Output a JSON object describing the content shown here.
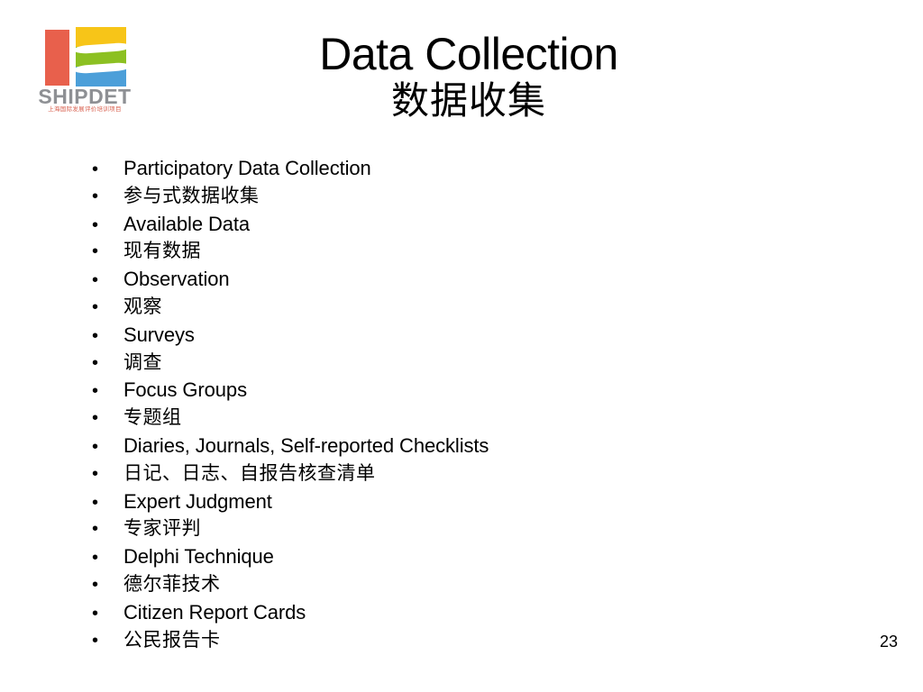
{
  "slide": {
    "title_en": "Data Collection",
    "title_zh": "数据收集",
    "page_number": "23",
    "background_color": "#FFFFFF",
    "text_color": "#000000"
  },
  "logo": {
    "wordmark": "SHIPDET",
    "subtext_zh": "上海国际发展评价培训项目",
    "wordmark_color": "#8E9094",
    "subtext_color": "#D8604F",
    "colors": {
      "bar_red": "#E8604C",
      "band_yellow": "#F7C518",
      "band_green": "#8CC022",
      "band_blue": "#4C9FD9"
    }
  },
  "bullets": [
    {
      "text": "Participatory Data Collection",
      "lang": "en"
    },
    {
      "text": "参与式数据收集",
      "lang": "zh"
    },
    {
      "text": "Available Data",
      "lang": "en"
    },
    {
      "text": "现有数据",
      "lang": "zh"
    },
    {
      "text": "Observation",
      "lang": "en"
    },
    {
      "text": "观察",
      "lang": "zh"
    },
    {
      "text": "Surveys",
      "lang": "en"
    },
    {
      "text": "调查",
      "lang": "zh"
    },
    {
      "text": "Focus Groups",
      "lang": "en"
    },
    {
      "text": "专题组",
      "lang": "zh"
    },
    {
      "text": "Diaries, Journals, Self-reported Checklists",
      "lang": "en"
    },
    {
      "text": "日记、日志、自报告核查清单",
      "lang": "zh"
    },
    {
      "text": "Expert Judgment",
      "lang": "en"
    },
    {
      "text": "专家评判",
      "lang": "zh"
    },
    {
      "text": "Delphi Technique",
      "lang": "en"
    },
    {
      "text": "德尔菲技术",
      "lang": "zh"
    },
    {
      "text": "Citizen Report Cards",
      "lang": "en"
    },
    {
      "text": "公民报告卡",
      "lang": "zh"
    }
  ],
  "bullet_glyph": "•"
}
